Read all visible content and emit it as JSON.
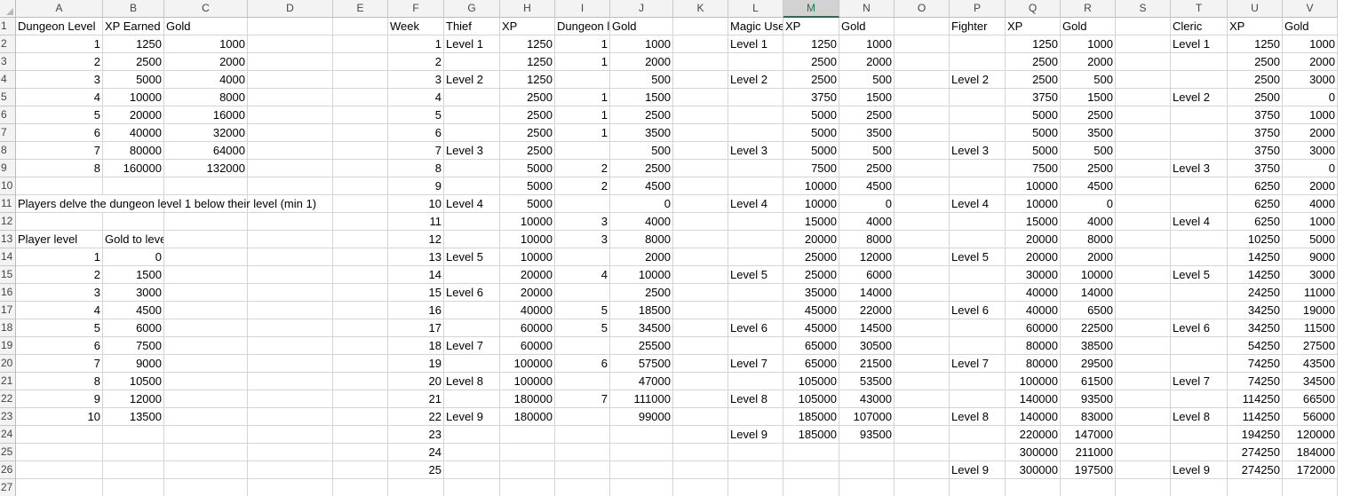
{
  "columns": [
    "A",
    "B",
    "C",
    "D",
    "E",
    "F",
    "G",
    "H",
    "I",
    "J",
    "K",
    "L",
    "M",
    "N",
    "O",
    "P",
    "Q",
    "R",
    "S",
    "T",
    "U",
    "V"
  ],
  "selected_column": "M",
  "row_numbers": [
    "1",
    "2",
    "3",
    "4",
    "5",
    "6",
    "7",
    "8",
    "9",
    "10",
    "11",
    "12",
    "13",
    "14",
    "15",
    "16",
    "17",
    "18",
    "19",
    "20",
    "21",
    "22",
    "23",
    "24",
    "25",
    "26",
    "27"
  ],
  "cells": [
    [
      "A1",
      "Dungeon Level"
    ],
    [
      "B1",
      "XP Earned"
    ],
    [
      "C1",
      "Gold"
    ],
    [
      "F1",
      "Week"
    ],
    [
      "G1",
      "Thief"
    ],
    [
      "H1",
      "XP"
    ],
    [
      "I1",
      "Dungeon l"
    ],
    [
      "J1",
      "Gold"
    ],
    [
      "L1",
      "Magic Use"
    ],
    [
      "M1",
      "XP"
    ],
    [
      "N1",
      "Gold"
    ],
    [
      "P1",
      "Fighter"
    ],
    [
      "Q1",
      "XP"
    ],
    [
      "R1",
      "Gold"
    ],
    [
      "T1",
      "Cleric"
    ],
    [
      "U1",
      "XP"
    ],
    [
      "V1",
      "Gold"
    ],
    [
      "A2",
      "1"
    ],
    [
      "B2",
      "1250"
    ],
    [
      "C2",
      "1000"
    ],
    [
      "F2",
      "1"
    ],
    [
      "G2",
      "Level 1"
    ],
    [
      "H2",
      "1250"
    ],
    [
      "I2",
      "1"
    ],
    [
      "J2",
      "1000"
    ],
    [
      "L2",
      "Level 1"
    ],
    [
      "M2",
      "1250"
    ],
    [
      "N2",
      "1000"
    ],
    [
      "Q2",
      "1250"
    ],
    [
      "R2",
      "1000"
    ],
    [
      "T2",
      "Level 1"
    ],
    [
      "U2",
      "1250"
    ],
    [
      "V2",
      "1000"
    ],
    [
      "A3",
      "2"
    ],
    [
      "B3",
      "2500"
    ],
    [
      "C3",
      "2000"
    ],
    [
      "F3",
      "2"
    ],
    [
      "H3",
      "1250"
    ],
    [
      "I3",
      "1"
    ],
    [
      "J3",
      "2000"
    ],
    [
      "M3",
      "2500"
    ],
    [
      "N3",
      "2000"
    ],
    [
      "Q3",
      "2500"
    ],
    [
      "R3",
      "2000"
    ],
    [
      "U3",
      "2500"
    ],
    [
      "V3",
      "2000"
    ],
    [
      "A4",
      "3"
    ],
    [
      "B4",
      "5000"
    ],
    [
      "C4",
      "4000"
    ],
    [
      "F4",
      "3"
    ],
    [
      "G4",
      "Level 2"
    ],
    [
      "H4",
      "1250"
    ],
    [
      "J4",
      "500"
    ],
    [
      "L4",
      "Level 2"
    ],
    [
      "M4",
      "2500"
    ],
    [
      "N4",
      "500"
    ],
    [
      "P4",
      "Level 2"
    ],
    [
      "Q4",
      "2500"
    ],
    [
      "R4",
      "500"
    ],
    [
      "U4",
      "2500"
    ],
    [
      "V4",
      "3000"
    ],
    [
      "A5",
      "4"
    ],
    [
      "B5",
      "10000"
    ],
    [
      "C5",
      "8000"
    ],
    [
      "F5",
      "4"
    ],
    [
      "H5",
      "2500"
    ],
    [
      "I5",
      "1"
    ],
    [
      "J5",
      "1500"
    ],
    [
      "M5",
      "3750"
    ],
    [
      "N5",
      "1500"
    ],
    [
      "Q5",
      "3750"
    ],
    [
      "R5",
      "1500"
    ],
    [
      "T5",
      "Level 2"
    ],
    [
      "U5",
      "2500"
    ],
    [
      "V5",
      "0"
    ],
    [
      "A6",
      "5"
    ],
    [
      "B6",
      "20000"
    ],
    [
      "C6",
      "16000"
    ],
    [
      "F6",
      "5"
    ],
    [
      "H6",
      "2500"
    ],
    [
      "I6",
      "1"
    ],
    [
      "J6",
      "2500"
    ],
    [
      "M6",
      "5000"
    ],
    [
      "N6",
      "2500"
    ],
    [
      "Q6",
      "5000"
    ],
    [
      "R6",
      "2500"
    ],
    [
      "U6",
      "3750"
    ],
    [
      "V6",
      "1000"
    ],
    [
      "A7",
      "6"
    ],
    [
      "B7",
      "40000"
    ],
    [
      "C7",
      "32000"
    ],
    [
      "F7",
      "6"
    ],
    [
      "H7",
      "2500"
    ],
    [
      "I7",
      "1"
    ],
    [
      "J7",
      "3500"
    ],
    [
      "M7",
      "5000"
    ],
    [
      "N7",
      "3500"
    ],
    [
      "Q7",
      "5000"
    ],
    [
      "R7",
      "3500"
    ],
    [
      "U7",
      "3750"
    ],
    [
      "V7",
      "2000"
    ],
    [
      "A8",
      "7"
    ],
    [
      "B8",
      "80000"
    ],
    [
      "C8",
      "64000"
    ],
    [
      "F8",
      "7"
    ],
    [
      "G8",
      "Level 3"
    ],
    [
      "H8",
      "2500"
    ],
    [
      "J8",
      "500"
    ],
    [
      "L8",
      "Level 3"
    ],
    [
      "M8",
      "5000"
    ],
    [
      "N8",
      "500"
    ],
    [
      "P8",
      "Level 3"
    ],
    [
      "Q8",
      "5000"
    ],
    [
      "R8",
      "500"
    ],
    [
      "U8",
      "3750"
    ],
    [
      "V8",
      "3000"
    ],
    [
      "A9",
      "8"
    ],
    [
      "B9",
      "160000"
    ],
    [
      "C9",
      "132000"
    ],
    [
      "F9",
      "8"
    ],
    [
      "H9",
      "5000"
    ],
    [
      "I9",
      "2"
    ],
    [
      "J9",
      "2500"
    ],
    [
      "M9",
      "7500"
    ],
    [
      "N9",
      "2500"
    ],
    [
      "Q9",
      "7500"
    ],
    [
      "R9",
      "2500"
    ],
    [
      "T9",
      "Level 3"
    ],
    [
      "U9",
      "3750"
    ],
    [
      "V9",
      "0"
    ],
    [
      "F10",
      "9"
    ],
    [
      "H10",
      "5000"
    ],
    [
      "I10",
      "2"
    ],
    [
      "J10",
      "4500"
    ],
    [
      "M10",
      "10000"
    ],
    [
      "N10",
      "4500"
    ],
    [
      "Q10",
      "10000"
    ],
    [
      "R10",
      "4500"
    ],
    [
      "U10",
      "6250"
    ],
    [
      "V10",
      "2000"
    ],
    [
      "A11",
      "Players delve the dungeon level 1 below their level (min 1)"
    ],
    [
      "F11",
      "10"
    ],
    [
      "G11",
      "Level 4"
    ],
    [
      "H11",
      "5000"
    ],
    [
      "J11",
      "0"
    ],
    [
      "L11",
      "Level 4"
    ],
    [
      "M11",
      "10000"
    ],
    [
      "N11",
      "0"
    ],
    [
      "P11",
      "Level 4"
    ],
    [
      "Q11",
      "10000"
    ],
    [
      "R11",
      "0"
    ],
    [
      "U11",
      "6250"
    ],
    [
      "V11",
      "4000"
    ],
    [
      "F12",
      "11"
    ],
    [
      "H12",
      "10000"
    ],
    [
      "I12",
      "3"
    ],
    [
      "J12",
      "4000"
    ],
    [
      "M12",
      "15000"
    ],
    [
      "N12",
      "4000"
    ],
    [
      "Q12",
      "15000"
    ],
    [
      "R12",
      "4000"
    ],
    [
      "T12",
      "Level 4"
    ],
    [
      "U12",
      "6250"
    ],
    [
      "V12",
      "1000"
    ],
    [
      "A13",
      "Player level"
    ],
    [
      "B13",
      "Gold to level"
    ],
    [
      "F13",
      "12"
    ],
    [
      "H13",
      "10000"
    ],
    [
      "I13",
      "3"
    ],
    [
      "J13",
      "8000"
    ],
    [
      "M13",
      "20000"
    ],
    [
      "N13",
      "8000"
    ],
    [
      "Q13",
      "20000"
    ],
    [
      "R13",
      "8000"
    ],
    [
      "U13",
      "10250"
    ],
    [
      "V13",
      "5000"
    ],
    [
      "A14",
      "1"
    ],
    [
      "B14",
      "0"
    ],
    [
      "F14",
      "13"
    ],
    [
      "G14",
      "Level 5"
    ],
    [
      "H14",
      "10000"
    ],
    [
      "J14",
      "2000"
    ],
    [
      "M14",
      "25000"
    ],
    [
      "N14",
      "12000"
    ],
    [
      "P14",
      "Level 5"
    ],
    [
      "Q14",
      "20000"
    ],
    [
      "R14",
      "2000"
    ],
    [
      "U14",
      "14250"
    ],
    [
      "V14",
      "9000"
    ],
    [
      "A15",
      "2"
    ],
    [
      "B15",
      "1500"
    ],
    [
      "F15",
      "14"
    ],
    [
      "H15",
      "20000"
    ],
    [
      "I15",
      "4"
    ],
    [
      "J15",
      "10000"
    ],
    [
      "L15",
      "Level 5"
    ],
    [
      "M15",
      "25000"
    ],
    [
      "N15",
      "6000"
    ],
    [
      "Q15",
      "30000"
    ],
    [
      "R15",
      "10000"
    ],
    [
      "T15",
      "Level 5"
    ],
    [
      "U15",
      "14250"
    ],
    [
      "V15",
      "3000"
    ],
    [
      "A16",
      "3"
    ],
    [
      "B16",
      "3000"
    ],
    [
      "F16",
      "15"
    ],
    [
      "G16",
      "Level 6"
    ],
    [
      "H16",
      "20000"
    ],
    [
      "J16",
      "2500"
    ],
    [
      "M16",
      "35000"
    ],
    [
      "N16",
      "14000"
    ],
    [
      "Q16",
      "40000"
    ],
    [
      "R16",
      "14000"
    ],
    [
      "U16",
      "24250"
    ],
    [
      "V16",
      "11000"
    ],
    [
      "A17",
      "4"
    ],
    [
      "B17",
      "4500"
    ],
    [
      "F17",
      "16"
    ],
    [
      "H17",
      "40000"
    ],
    [
      "I17",
      "5"
    ],
    [
      "J17",
      "18500"
    ],
    [
      "M17",
      "45000"
    ],
    [
      "N17",
      "22000"
    ],
    [
      "P17",
      "Level 6"
    ],
    [
      "Q17",
      "40000"
    ],
    [
      "R17",
      "6500"
    ],
    [
      "U17",
      "34250"
    ],
    [
      "V17",
      "19000"
    ],
    [
      "A18",
      "5"
    ],
    [
      "B18",
      "6000"
    ],
    [
      "F18",
      "17"
    ],
    [
      "H18",
      "60000"
    ],
    [
      "I18",
      "5"
    ],
    [
      "J18",
      "34500"
    ],
    [
      "L18",
      "Level 6"
    ],
    [
      "M18",
      "45000"
    ],
    [
      "N18",
      "14500"
    ],
    [
      "Q18",
      "60000"
    ],
    [
      "R18",
      "22500"
    ],
    [
      "T18",
      "Level 6"
    ],
    [
      "U18",
      "34250"
    ],
    [
      "V18",
      "11500"
    ],
    [
      "A19",
      "6"
    ],
    [
      "B19",
      "7500"
    ],
    [
      "F19",
      "18"
    ],
    [
      "G19",
      "Level 7"
    ],
    [
      "H19",
      "60000"
    ],
    [
      "J19",
      "25500"
    ],
    [
      "M19",
      "65000"
    ],
    [
      "N19",
      "30500"
    ],
    [
      "Q19",
      "80000"
    ],
    [
      "R19",
      "38500"
    ],
    [
      "U19",
      "54250"
    ],
    [
      "V19",
      "27500"
    ],
    [
      "A20",
      "7"
    ],
    [
      "B20",
      "9000"
    ],
    [
      "F20",
      "19"
    ],
    [
      "H20",
      "100000"
    ],
    [
      "I20",
      "6"
    ],
    [
      "J20",
      "57500"
    ],
    [
      "L20",
      "Level 7"
    ],
    [
      "M20",
      "65000"
    ],
    [
      "N20",
      "21500"
    ],
    [
      "P20",
      "Level 7"
    ],
    [
      "Q20",
      "80000"
    ],
    [
      "R20",
      "29500"
    ],
    [
      "U20",
      "74250"
    ],
    [
      "V20",
      "43500"
    ],
    [
      "A21",
      "8"
    ],
    [
      "B21",
      "10500"
    ],
    [
      "F21",
      "20"
    ],
    [
      "G21",
      "Level 8"
    ],
    [
      "H21",
      "100000"
    ],
    [
      "J21",
      "47000"
    ],
    [
      "M21",
      "105000"
    ],
    [
      "N21",
      "53500"
    ],
    [
      "Q21",
      "100000"
    ],
    [
      "R21",
      "61500"
    ],
    [
      "T21",
      "Level 7"
    ],
    [
      "U21",
      "74250"
    ],
    [
      "V21",
      "34500"
    ],
    [
      "A22",
      "9"
    ],
    [
      "B22",
      "12000"
    ],
    [
      "F22",
      "21"
    ],
    [
      "H22",
      "180000"
    ],
    [
      "I22",
      "7"
    ],
    [
      "J22",
      "111000"
    ],
    [
      "L22",
      "Level 8"
    ],
    [
      "M22",
      "105000"
    ],
    [
      "N22",
      "43000"
    ],
    [
      "Q22",
      "140000"
    ],
    [
      "R22",
      "93500"
    ],
    [
      "U22",
      "114250"
    ],
    [
      "V22",
      "66500"
    ],
    [
      "A23",
      "10"
    ],
    [
      "B23",
      "13500"
    ],
    [
      "F23",
      "22"
    ],
    [
      "G23",
      "Level 9"
    ],
    [
      "H23",
      "180000"
    ],
    [
      "J23",
      "99000"
    ],
    [
      "M23",
      "185000"
    ],
    [
      "N23",
      "107000"
    ],
    [
      "P23",
      "Level 8"
    ],
    [
      "Q23",
      "140000"
    ],
    [
      "R23",
      "83000"
    ],
    [
      "T23",
      "Level 8"
    ],
    [
      "U23",
      "114250"
    ],
    [
      "V23",
      "56000"
    ],
    [
      "F24",
      "23"
    ],
    [
      "L24",
      "Level 9"
    ],
    [
      "M24",
      "185000"
    ],
    [
      "N24",
      "93500"
    ],
    [
      "Q24",
      "220000"
    ],
    [
      "R24",
      "147000"
    ],
    [
      "U24",
      "194250"
    ],
    [
      "V24",
      "120000"
    ],
    [
      "F25",
      "24"
    ],
    [
      "Q25",
      "300000"
    ],
    [
      "R25",
      "211000"
    ],
    [
      "U25",
      "274250"
    ],
    [
      "V25",
      "184000"
    ],
    [
      "F26",
      "25"
    ],
    [
      "P26",
      "Level 9"
    ],
    [
      "Q26",
      "300000"
    ],
    [
      "R26",
      "197500"
    ],
    [
      "T26",
      "Level 9"
    ],
    [
      "U26",
      "274250"
    ],
    [
      "V26",
      "172000"
    ]
  ]
}
